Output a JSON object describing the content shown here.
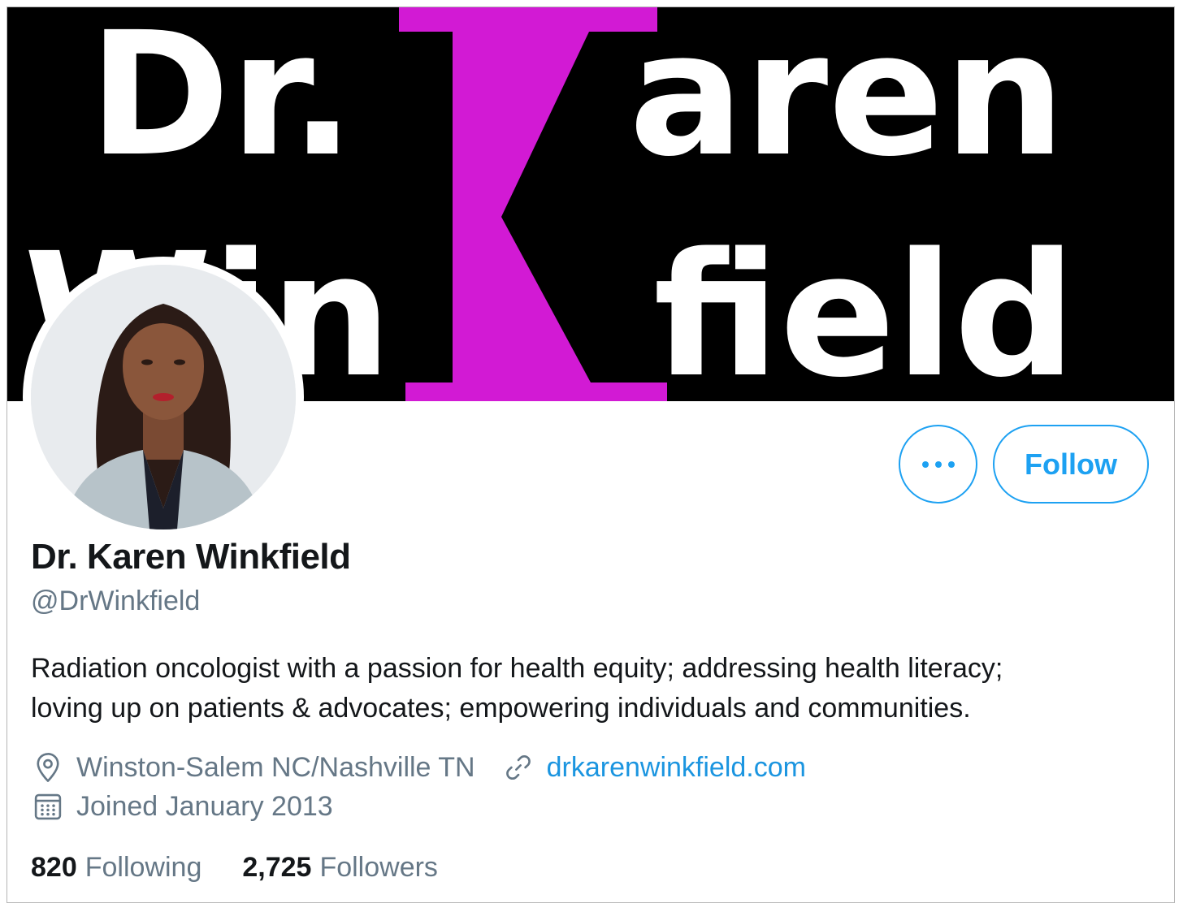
{
  "banner": {
    "line1_part1": "Dr.",
    "line1_part2": "aren",
    "line2_part1": "Win",
    "line2_part2": "field",
    "monogram": "K",
    "text_color": "#ffffff",
    "monogram_color": "#d21ad4",
    "background": "#000000"
  },
  "profile": {
    "display_name": "Dr. Karen Winkfield",
    "handle": "@DrWinkfield",
    "bio_line1": "Radiation oncologist with a passion for health equity; addressing health literacy;",
    "bio_line2": "loving up on patients & advocates; empowering individuals and communities.",
    "location": "Winston-Salem NC/Nashville TN",
    "website": "drkarenwinkfield.com",
    "joined": "Joined January 2013"
  },
  "actions": {
    "more_icon": "more-horizontal-icon",
    "follow_label": "Follow",
    "accent": "#1da1f2"
  },
  "stats": {
    "following_count": "820",
    "following_label": "Following",
    "followers_count": "2,725",
    "followers_label": "Followers"
  },
  "icons": {
    "location": "location-pin-icon",
    "link": "link-icon",
    "calendar": "calendar-icon"
  },
  "colors": {
    "primary_text": "#14171a",
    "secondary_text": "#657786",
    "link": "#1b95e0"
  }
}
